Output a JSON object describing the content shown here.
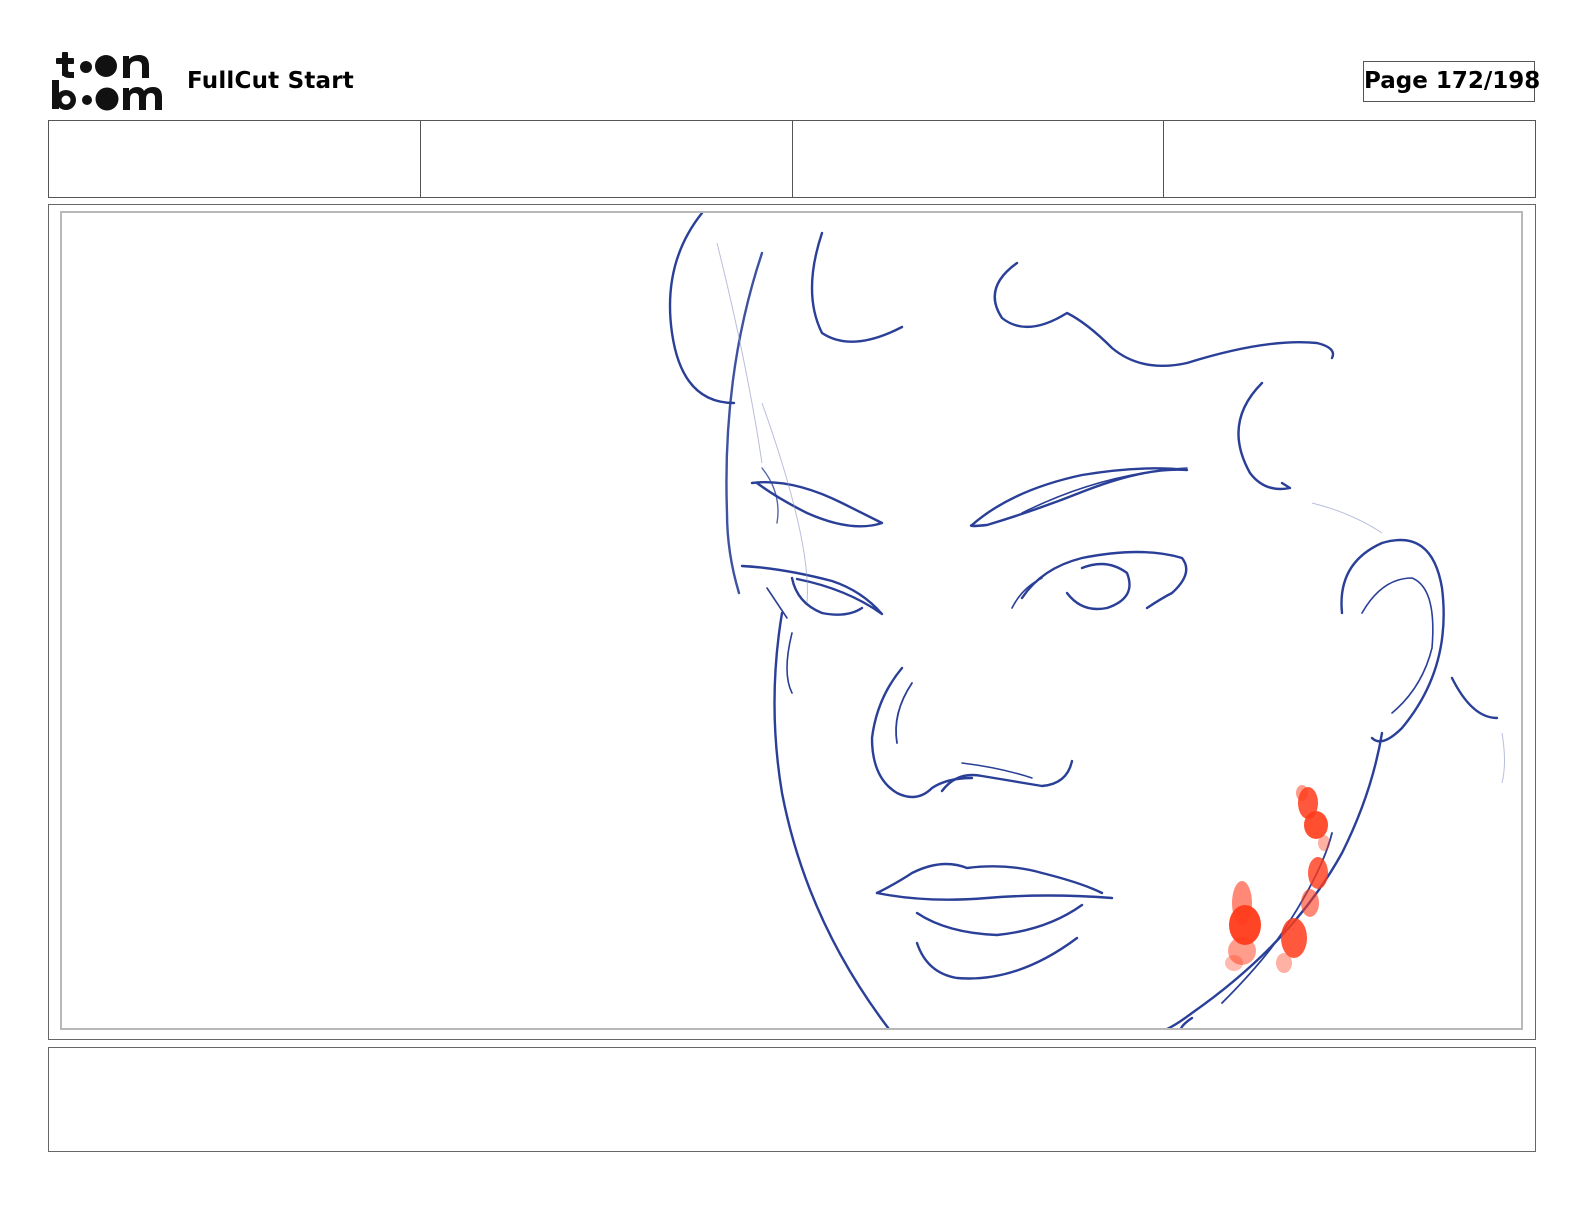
{
  "header": {
    "logo_text": [
      "toon",
      "boom"
    ],
    "project_title": "FullCut Start",
    "page_indicator": "Page 172/198"
  },
  "info_row": {
    "cells": [
      "",
      "",
      "",
      ""
    ]
  },
  "panel": {
    "ink_color": "#2a3f97",
    "blush_color": "#ff3b1a",
    "content": "sketch-of-face"
  },
  "caption": {
    "text": ""
  }
}
